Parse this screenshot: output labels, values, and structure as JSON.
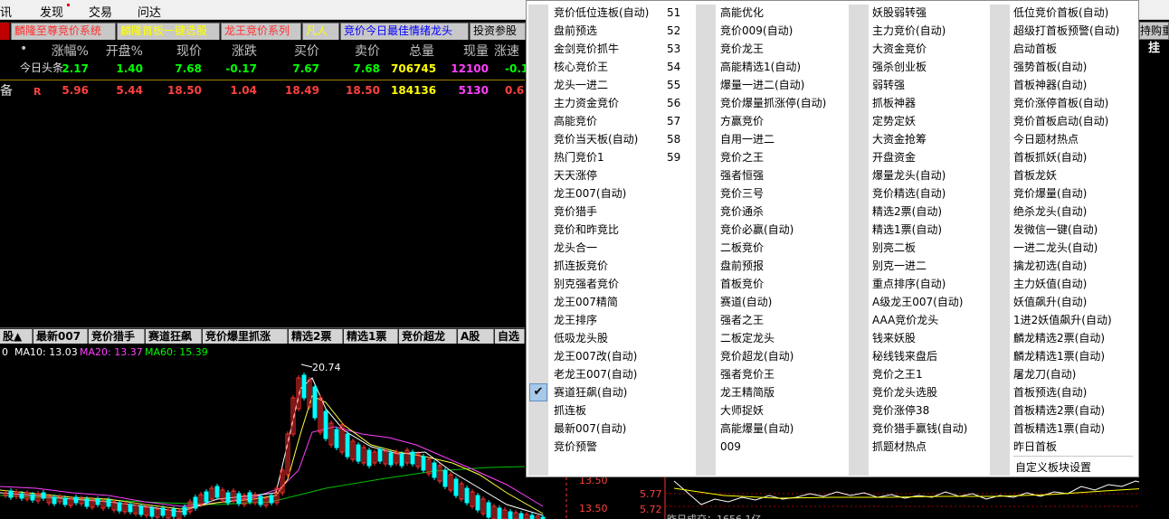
{
  "menubar": [
    {
      "label": "讯"
    },
    {
      "label": "发现"
    },
    {
      "label": "交易"
    },
    {
      "label": "问达"
    }
  ],
  "top_tabs": [
    {
      "label": "麟隆至尊竞价系统",
      "color": "#ff3030"
    },
    {
      "label": "麟隆首板一键选股",
      "color": "#ffff00"
    },
    {
      "label": "龙王竞价系列",
      "color": "#ff3030"
    },
    {
      "label": "凡人",
      "color": "#ffff00"
    },
    {
      "label": "竞价今日最佳情绪龙头",
      "color": "#0000ff"
    },
    {
      "label": "投资参股",
      "color": "#000000"
    }
  ],
  "right_tab": "持购重",
  "headers": [
    "•",
    "涨幅%",
    "开盘%",
    "现价",
    "涨跌",
    "买价",
    "卖价",
    "总量",
    "现量",
    "涨速"
  ],
  "rows": [
    {
      "name": "今日头条",
      "mark": "",
      "cells": [
        "2.17",
        "1.40",
        "7.68",
        "-0.17",
        "7.67",
        "7.68",
        "706745",
        "12100",
        "-0.1"
      ]
    },
    {
      "name": "备",
      "mark": "R",
      "cells": [
        "5.96",
        "5.44",
        "18.50",
        "1.04",
        "18.49",
        "18.50",
        "184136",
        "5130",
        "0.6"
      ]
    }
  ],
  "bottom_tabs": [
    "股▲",
    "最新007",
    "竞价猎手",
    "赛道狂飙",
    "竞价爆里抓涨",
    "精选2票",
    "精选1票",
    "竞价超龙",
    "A股",
    "自选"
  ],
  "ma": [
    {
      "label": "0",
      "color": "#ffffff"
    },
    {
      "label": "MA10: 13.03",
      "color": "#ffffff"
    },
    {
      "label": "MA20: 13.37",
      "color": "#ff40ff"
    },
    {
      "label": "MA60: 15.39",
      "color": "#00ff00"
    }
  ],
  "chart_labels": {
    "peak": "20.74",
    "level1": "13.50",
    "level2": "13.50",
    "p1": "5.77",
    "p2": "5.72",
    "bottom": "昨日成交：1656.1亿"
  },
  "menu": {
    "col1": [
      "竞价低位连板(自动)",
      "盘前预选",
      "金剑竞价抓牛",
      "核心竞价王",
      "龙头一进二",
      "主力资金竞价",
      "高能竞价",
      "竞价当天板(自动)",
      "热门竞价1",
      "天天涨停",
      "龙王007(自动)",
      "竞价猎手",
      "竞价和昨竞比",
      "龙头合一",
      "抓连扳竞价",
      "别克强者竞价",
      "龙王007精简",
      "龙王排序",
      "低吸龙头股",
      "龙王007改(自动)",
      "老龙王007(自动)",
      "赛道狂飙(自动)",
      "抓连板",
      "最新007(自动)",
      "竞价预警"
    ],
    "col1_nums": [
      "51",
      "52",
      "53",
      "54",
      "55",
      "56",
      "57",
      "58",
      "59"
    ],
    "col1_checked": "赛道狂飙(自动)",
    "col2": [
      "高能优化",
      "竞价009(自动)",
      "竞价龙王",
      "高能精选1(自动)",
      "爆量一进二(自动)",
      "竞价爆量抓涨停(自动)",
      "方赢竞价",
      "自用一进二",
      "竞价之王",
      "强者恒强",
      "竞价三号",
      "竞价通杀",
      "竞价必赢(自动)",
      "二板竞价",
      "盘前预报",
      "首板竞价",
      "赛道(自动)",
      "强者之王",
      "二板定龙头",
      "竞价超龙(自动)",
      "强者竞价王",
      "龙王精简版",
      "大师捉妖",
      "高能爆量(自动)",
      "009"
    ],
    "col3": [
      "妖股弱转强",
      "主力竞价(自动)",
      "大资金竞价",
      "强杀创业板",
      "弱转强",
      "抓板神器",
      "定势定妖",
      "大资金抢筹",
      "开盘资金",
      "爆量龙头(自动)",
      "竞价精选(自动)",
      "精选2票(自动)",
      "精选1票(自动)",
      "别亮二板",
      "别克一进二",
      "重点排序(自动)",
      "A级龙王007(自动)",
      "AAA竞价龙头",
      "钱来妖股",
      "秘线钱来盘后",
      "竞价之王1",
      "竞价龙头选股",
      "竞价涨停38",
      "竞价猎手赢钱(自动)",
      "抓题材热点"
    ],
    "col4": [
      "低位竞价首板(自动)",
      "超级打首板预警(自动)",
      "启动首板",
      "强势首板(自动)",
      "首板神器(自动)",
      "竞价涨停首板(自动)",
      "竞价首板启动(自动)",
      "今日题材热点",
      "首板抓妖(自动)",
      "首板龙妖",
      "竞价爆量(自动)",
      "绝杀龙头(自动)",
      "发微信一键(自动)",
      "一进二龙头(自动)",
      "擒龙初选(自动)",
      "主力妖值(自动)",
      "妖值飙升(自动)",
      "1进2妖值飙升(自动)",
      "麟龙精选2票(自动)",
      "麟龙精选1票(自动)",
      "屠龙刀(自动)",
      "首板预选(自动)",
      "首板精选2票(自动)",
      "首板精选1票(自动)",
      "昨日首板"
    ],
    "custom": "自定义板块设置"
  }
}
